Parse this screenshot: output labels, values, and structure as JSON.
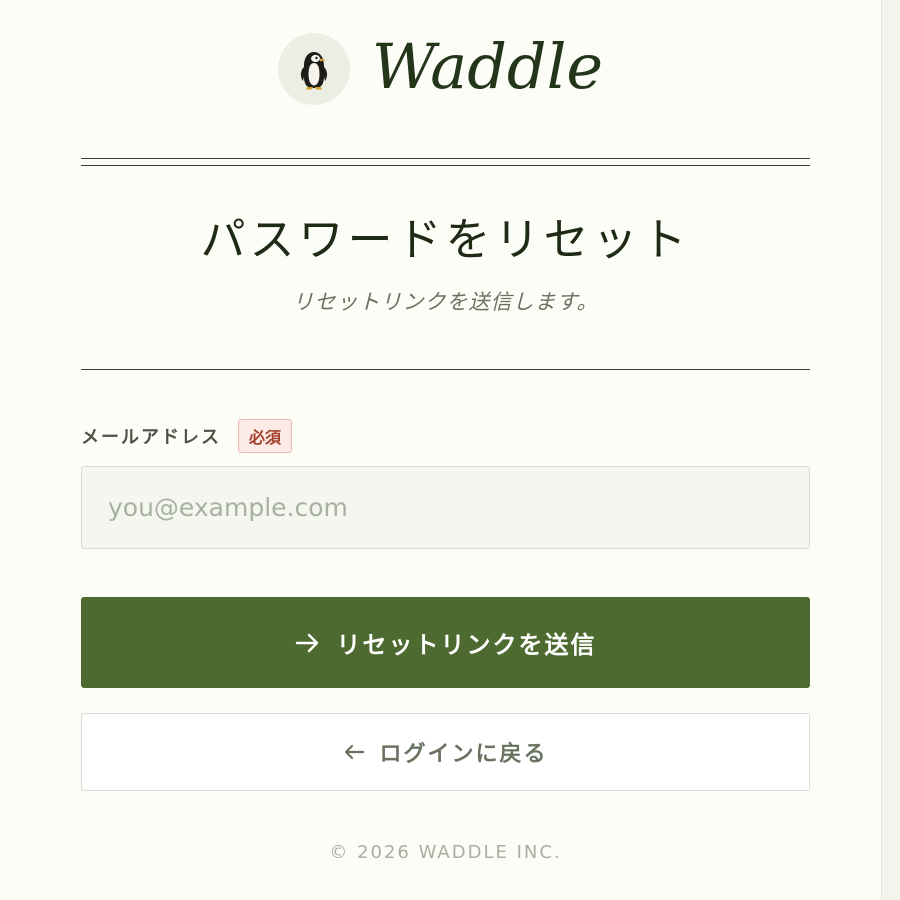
{
  "brand": {
    "name": "Waddle",
    "logo_icon": "penguin-icon"
  },
  "header": {
    "title": "パスワードをリセット",
    "subtitle": "リセットリンクを送信します。"
  },
  "form": {
    "email": {
      "label": "メールアドレス",
      "required_badge": "必須",
      "value": "",
      "placeholder": "you@example.com"
    },
    "submit": {
      "label": "リセットリンクを送信",
      "icon": "arrow-right-icon"
    },
    "back": {
      "label": "ログインに戻る",
      "icon": "arrow-left-icon"
    }
  },
  "footer": {
    "copyright": "© 2026 WADDLE INC."
  },
  "colors": {
    "accent": "#4d6a30",
    "brand_text": "#24361a",
    "required": "#a4422c",
    "background": "#fdfdf8"
  }
}
